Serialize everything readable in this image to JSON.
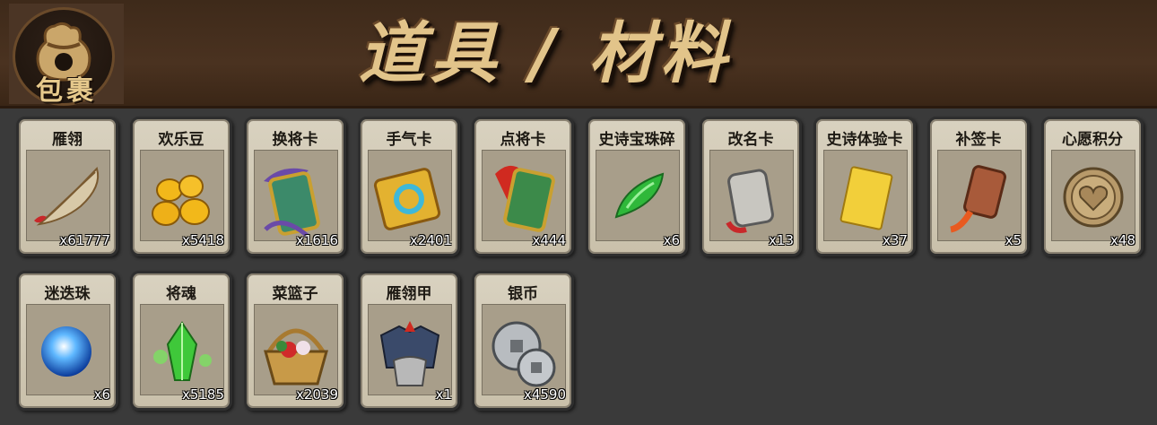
{
  "header": {
    "bag_label": "包裹",
    "title": "道具 / 材料"
  },
  "items": [
    {
      "name": "雁翎",
      "count": "x61777",
      "icon": "feather-icon"
    },
    {
      "name": "欢乐豆",
      "count": "x5418",
      "icon": "gold-beans-icon"
    },
    {
      "name": "换将卡",
      "count": "x1616",
      "icon": "swap-general-card-icon"
    },
    {
      "name": "手气卡",
      "count": "x2401",
      "icon": "luck-card-icon"
    },
    {
      "name": "点将卡",
      "count": "x444",
      "icon": "pick-general-card-icon"
    },
    {
      "name": "史诗宝珠碎",
      "count": "x6",
      "icon": "jade-shard-icon"
    },
    {
      "name": "改名卡",
      "count": "x13",
      "icon": "rename-card-icon"
    },
    {
      "name": "史诗体验卡",
      "count": "x37",
      "icon": "gold-card-icon"
    },
    {
      "name": "补签卡",
      "count": "x5",
      "icon": "sign-tag-icon"
    },
    {
      "name": "心愿积分",
      "count": "x48",
      "icon": "heart-coin-icon"
    },
    {
      "name": "迷迭珠",
      "count": "x6",
      "icon": "blue-orb-icon"
    },
    {
      "name": "将魂",
      "count": "x5185",
      "icon": "green-crystal-icon"
    },
    {
      "name": "菜篮子",
      "count": "x2039",
      "icon": "basket-icon"
    },
    {
      "name": "雁翎甲",
      "count": "x1",
      "icon": "armor-icon"
    },
    {
      "name": "银币",
      "count": "x4590",
      "icon": "silver-coins-icon"
    }
  ]
}
